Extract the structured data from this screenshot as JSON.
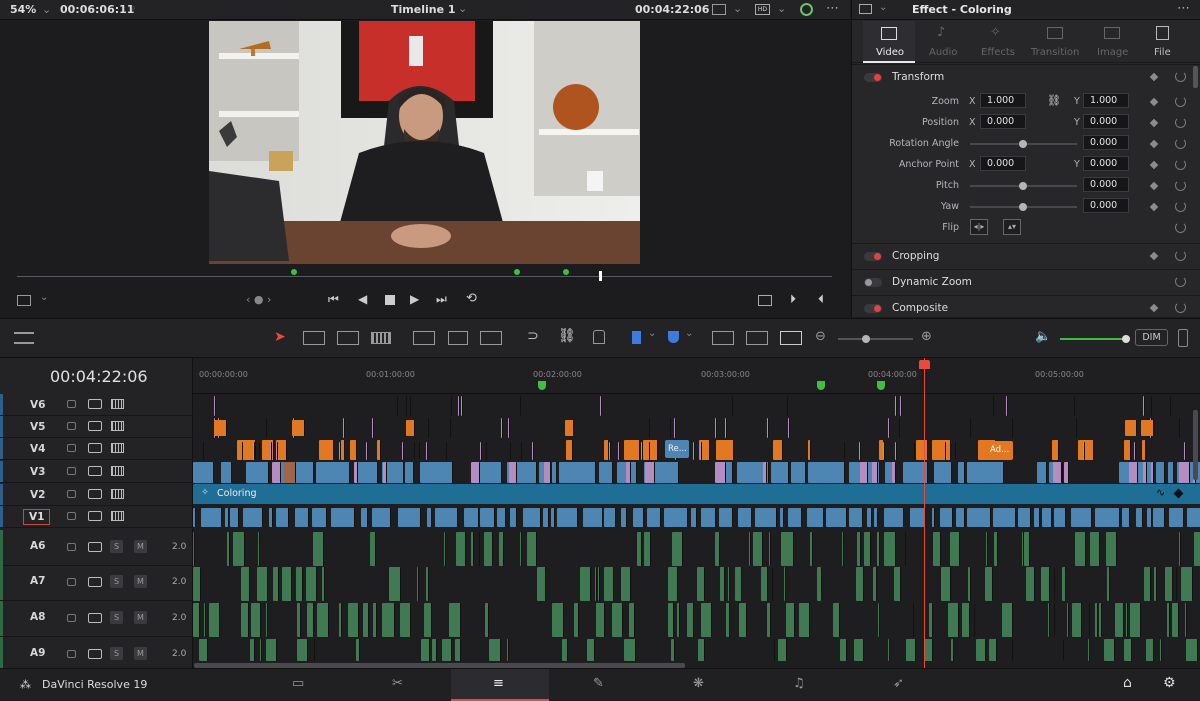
{
  "topbar": {
    "zoom": "54%",
    "source_timecode": "00:06:06:11",
    "timeline_name": "Timeline 1",
    "record_timecode": "00:04:22:06"
  },
  "inspector": {
    "title": "Effect - Coloring",
    "tabs": [
      {
        "label": "Video",
        "active": true
      },
      {
        "label": "Audio",
        "active": false
      },
      {
        "label": "Effects",
        "active": false
      },
      {
        "label": "Transition",
        "active": false
      },
      {
        "label": "Image",
        "active": false
      },
      {
        "label": "File",
        "active": false
      }
    ],
    "transform": {
      "label": "Transform",
      "zoom": {
        "label": "Zoom",
        "x": "1.000",
        "y": "1.000"
      },
      "position": {
        "label": "Position",
        "x": "0.000",
        "y": "0.000"
      },
      "rotation": {
        "label": "Rotation Angle",
        "value": "0.000"
      },
      "anchor": {
        "label": "Anchor Point",
        "x": "0.000",
        "y": "0.000"
      },
      "pitch": {
        "label": "Pitch",
        "value": "0.000"
      },
      "yaw": {
        "label": "Yaw",
        "value": "0.000"
      },
      "flip": {
        "label": "Flip"
      },
      "x_label": "X",
      "y_label": "Y"
    },
    "sections": [
      "Cropping",
      "Dynamic Zoom",
      "Composite"
    ]
  },
  "timeline": {
    "timecode": "00:04:22:06",
    "ruler": [
      "00:00:00:00",
      "00:01:00:00",
      "00:02:00:00",
      "00:03:00:00",
      "00:04:00:00",
      "00:05:00:00"
    ],
    "video_tracks": [
      "V6",
      "V5",
      "V4",
      "V3",
      "V2",
      "V1"
    ],
    "audio_tracks": [
      {
        "name": "A6",
        "level": "2.0"
      },
      {
        "name": "A7",
        "level": "2.0"
      },
      {
        "name": "A8",
        "level": "2.0"
      },
      {
        "name": "A9",
        "level": "2.0"
      }
    ],
    "solo_label": "S",
    "mute_label": "M",
    "adjustment_clip": "Coloring",
    "clip_labels": {
      "v3": "Re...",
      "v4": "Ad..."
    },
    "dim_label": "DIM",
    "colors": {
      "playhead": "#e64b3c",
      "video_clip": "#4d86b3",
      "orange_clip": "#e27822",
      "pink_clip": "#b58cc0",
      "audio_clip": "#3f7a52",
      "adjust_clip": "#1f6e96"
    }
  },
  "app": {
    "name": "DaVinci Resolve 19"
  },
  "pages": [
    "media-icon",
    "cut-icon",
    "edit-icon",
    "fusion-icon",
    "color-icon",
    "fairlight-icon",
    "deliver-icon"
  ]
}
